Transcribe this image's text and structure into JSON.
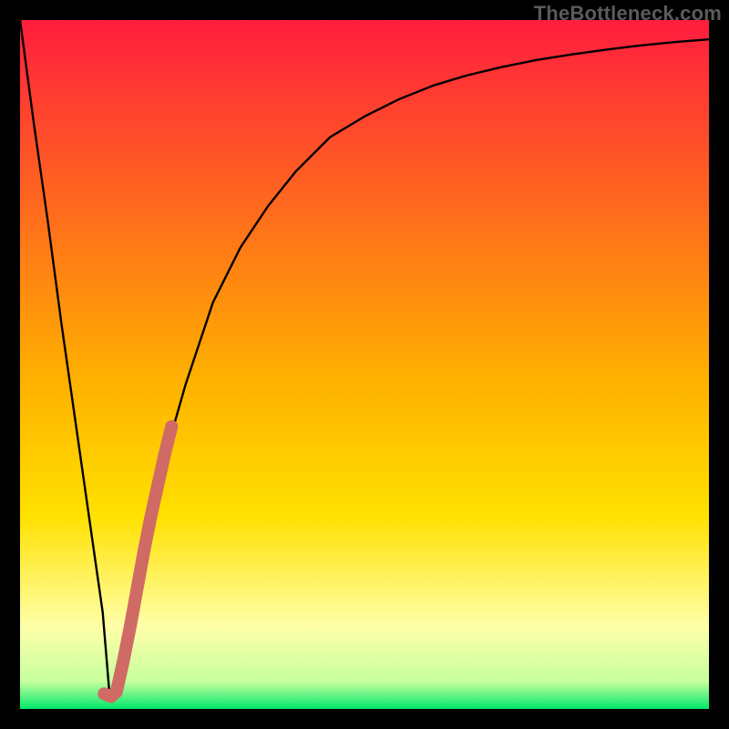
{
  "watermark": "TheBottleneck.com",
  "colors": {
    "frame": "#000000",
    "gradient_top": "#ff1d3e",
    "gradient_yellow": "#ffe100",
    "gradient_pale": "#ffffa8",
    "gradient_green": "#00e86b",
    "curve": "#000000",
    "overlay": "#cf6a65"
  },
  "chart_data": {
    "type": "line",
    "title": "",
    "xlabel": "",
    "ylabel": "",
    "xlim": [
      0,
      100
    ],
    "ylim": [
      0,
      100
    ],
    "series": [
      {
        "name": "main-curve",
        "x": [
          0,
          2,
          4,
          6,
          8,
          10,
          12,
          13,
          14,
          16,
          18,
          20,
          24,
          28,
          32,
          36,
          40,
          45,
          50,
          55,
          60,
          65,
          70,
          75,
          80,
          85,
          90,
          95,
          100
        ],
        "y": [
          100,
          85,
          71,
          56,
          42,
          28,
          14,
          2,
          3,
          14,
          24,
          33,
          47,
          59,
          67,
          73,
          78,
          83,
          86,
          88.5,
          90.5,
          92,
          93.2,
          94.2,
          95,
          95.7,
          96.3,
          96.8,
          97.2
        ]
      },
      {
        "name": "overlay-segment",
        "x": [
          12.2,
          13.2,
          14.0,
          15.0,
          16.0,
          17.0,
          18.0,
          19.0,
          20.0,
          21.0,
          22.0
        ],
        "y": [
          2.2,
          1.8,
          2.5,
          7.0,
          12.0,
          17.5,
          23.0,
          28.0,
          32.5,
          37.0,
          41.0
        ]
      }
    ]
  }
}
